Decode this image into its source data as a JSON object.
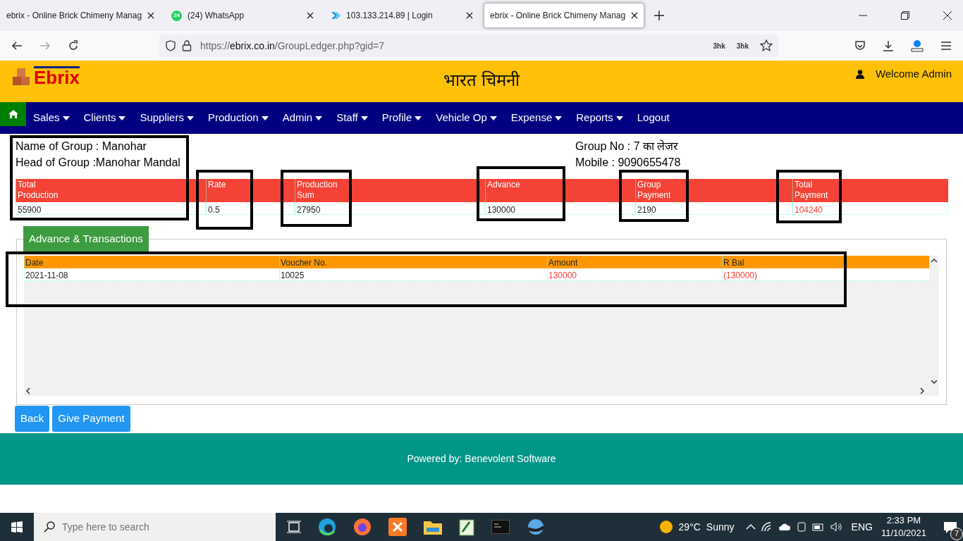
{
  "browser": {
    "tabs": [
      {
        "kind": "plain",
        "title": "ebrix - Online Brick Chimeny Manag",
        "selected": false
      },
      {
        "kind": "chat",
        "title": "(24) WhatsApp",
        "badge": "24",
        "selected": false
      },
      {
        "kind": "arrow",
        "title": "103.133.214.89 | Login",
        "selected": false
      },
      {
        "kind": "plain",
        "title": "ebrix - Online Brick Chimeny Manag",
        "selected": true
      }
    ],
    "url": {
      "scheme": "https://",
      "domain": "ebrix.co.in",
      "path": "/GroupLedger.php?gid=7"
    },
    "extensions": [
      "3hk",
      "3hk"
    ]
  },
  "header": {
    "logo": "Ebrix",
    "title": "भारत चिमनी",
    "welcome": "Welcome Admin"
  },
  "nav": [
    {
      "label": "Sales",
      "dropdown": true
    },
    {
      "label": "Clients",
      "dropdown": true
    },
    {
      "label": "Suppliers",
      "dropdown": true
    },
    {
      "label": "Production",
      "dropdown": true
    },
    {
      "label": "Admin",
      "dropdown": true
    },
    {
      "label": "Staff",
      "dropdown": true
    },
    {
      "label": "Profile",
      "dropdown": true
    },
    {
      "label": "Vehicle Op",
      "dropdown": true
    },
    {
      "label": "Expense",
      "dropdown": true
    },
    {
      "label": "Reports",
      "dropdown": true
    },
    {
      "label": "Logout",
      "dropdown": false
    }
  ],
  "group_info": {
    "name": "Name of Group : Manohar",
    "head": "Head of Group :Manohar Mandal",
    "group_no": "Group No : 7 का लेजर",
    "mobile": "Mobile : 9090655478"
  },
  "summary": [
    {
      "heading": "Total Production",
      "value": "55900",
      "highlight": false
    },
    {
      "heading": "Rate",
      "value": "0.5",
      "highlight": false
    },
    {
      "heading": "Production Sum",
      "value": "27950",
      "highlight": false
    },
    {
      "heading": "Advance",
      "value": "130000",
      "highlight": false
    },
    {
      "heading": "Group Payment",
      "value": "2190",
      "highlight": false
    },
    {
      "heading": "Total Payment",
      "value": "104240",
      "highlight": true
    }
  ],
  "transactions": {
    "tab": "Advance & Transactions",
    "columns": [
      "Date",
      "Voucher No.",
      "Amount",
      "R Bal"
    ],
    "rows": [
      {
        "cells": [
          "2021-11-08",
          "10025",
          "130000",
          "(130000)"
        ]
      }
    ]
  },
  "buttons": [
    "Back",
    "Give Payment"
  ],
  "footer": {
    "text": "Powered by:",
    "link": "Benevolent Software"
  },
  "taskbar": {
    "search": {
      "placeholder": "Type here to search"
    },
    "temperature": "29°C",
    "weather": "Sunny",
    "language": "ENG",
    "time": "2:33 PM",
    "date": "11/10/2021",
    "notifications": "7"
  }
}
